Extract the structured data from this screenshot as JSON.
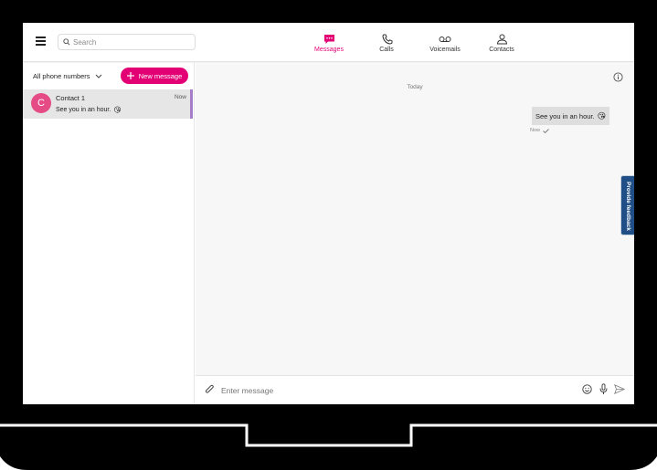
{
  "header": {
    "search_placeholder": "Search",
    "tabs": [
      {
        "label": "Messages",
        "active": true
      },
      {
        "label": "Calls",
        "active": false
      },
      {
        "label": "Voicemails",
        "active": false
      },
      {
        "label": "Contacts",
        "active": false
      }
    ]
  },
  "sidebar": {
    "filter_label": "All phone numbers",
    "new_message_label": "New message",
    "conversations": [
      {
        "avatar_letter": "C",
        "name": "Contact 1",
        "time": "Now",
        "preview": "See you in an hour.",
        "preview_emoji": "😘"
      }
    ]
  },
  "chat": {
    "day_label": "Today",
    "messages": [
      {
        "text": "See you in an hour.",
        "emoji": "😘",
        "time": "Now",
        "status_icon": "check-icon"
      }
    ]
  },
  "feedback_label": "Provide feedback",
  "composer": {
    "placeholder": "Enter message"
  },
  "colors": {
    "accent": "#e20074",
    "avatar": "#e54b85",
    "selected_bar": "#a77dc9",
    "feedback": "#1f4f86"
  }
}
